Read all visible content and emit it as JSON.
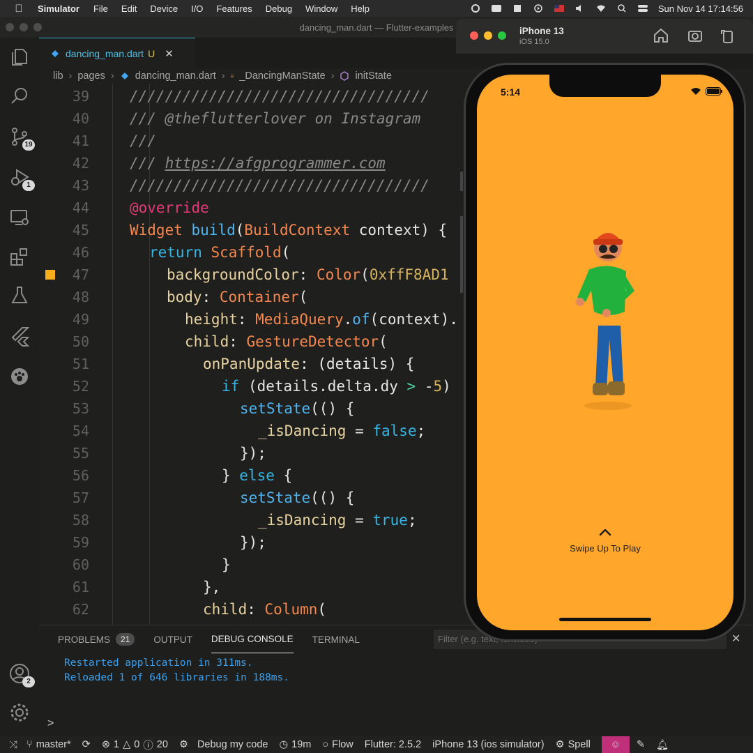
{
  "menubar": {
    "app": "Simulator",
    "items": [
      "File",
      "Edit",
      "Device",
      "I/O",
      "Features",
      "Debug",
      "Window",
      "Help"
    ],
    "clock": "Sun Nov 14  17:14:56"
  },
  "window_title": "dancing_man.dart — Flutter-examples",
  "tab": {
    "label": "dancing_man.dart",
    "status": "U",
    "close": "✕"
  },
  "breadcrumb": [
    "lib",
    "pages",
    "dancing_man.dart",
    "_DancingManState",
    "initState"
  ],
  "activity_badges": {
    "source_control": "19",
    "debug": "1",
    "accounts": "2"
  },
  "code": {
    "line_numbers": [
      "39",
      "40",
      "41",
      "42",
      "43",
      "44",
      "45",
      "46",
      "47",
      "48",
      "49",
      "50",
      "51",
      "52",
      "53",
      "54",
      "55",
      "56",
      "57",
      "58",
      "59",
      "60",
      "61",
      "62"
    ],
    "l39": "//////////////////////////////////",
    "l40": "/// @theflutterlover on Instagram",
    "l41": "///",
    "l42a": "/// ",
    "l42b": "https://afgprogrammer.com",
    "l43": "//////////////////////////////////",
    "l44": "@override",
    "l45a": "Widget",
    "l45b": "build",
    "l45c": "(",
    "l45d": "BuildContext",
    "l45e": " context) {",
    "l46a": "return",
    "l46b": "Scaffold",
    "l46c": "(",
    "l47a": "backgroundColor",
    "l47b": ": ",
    "l47c": "Color",
    "l47d": "(",
    "l47e": "0xffF8AD1",
    "l48a": "body",
    "l48b": ": ",
    "l48c": "Container",
    "l48d": "(",
    "l49a": "height",
    "l49b": ": ",
    "l49c": "MediaQuery",
    "l49d": ".",
    "l49e": "of",
    "l49f": "(context).",
    "l50a": "child",
    "l50b": ": ",
    "l50c": "GestureDetector",
    "l50d": "(",
    "l51a": "onPanUpdate",
    "l51b": ": (details) {",
    "l52a": "if",
    "l52b": " (details.delta.dy ",
    "l52c": ">",
    "l52d": " -",
    "l52e": "5",
    "l52f": ")",
    "l53a": "setState",
    "l53b": "(() {",
    "l54a": "_isDancing",
    "l54b": " = ",
    "l54c": "false",
    "l54d": ";",
    "l55": "});",
    "l56a": "} ",
    "l56b": "else",
    "l56c": " {",
    "l57a": "setState",
    "l57b": "(() {",
    "l58a": "_isDancing",
    "l58b": " = ",
    "l58c": "true",
    "l58d": ";",
    "l59": "});",
    "l60": "}",
    "l61": "},",
    "l62a": "child",
    "l62b": ": ",
    "l62c": "Column",
    "l62d": "("
  },
  "panel": {
    "tabs": [
      "PROBLEMS",
      "OUTPUT",
      "DEBUG CONSOLE",
      "TERMINAL"
    ],
    "problems_count": "21",
    "filter_placeholder": "Filter (e.g. text, !exclude)",
    "console_lines": [
      "Restarted application in 311ms.",
      "Reloaded 1 of 646 libraries in 188ms."
    ],
    "prompt": ">"
  },
  "statusbar": {
    "branch": "master*",
    "errors": "1",
    "warnings": "0",
    "infos": "20",
    "debug": "Debug my code",
    "time": "19m",
    "flow": "Flow",
    "flutter": "Flutter: 2.5.2",
    "device": "iPhone 13 (ios simulator)",
    "spell": "Spell"
  },
  "simulator": {
    "device_name": "iPhone 13",
    "os": "iOS 15.0",
    "phone_time": "5:14",
    "swipe_label": "Swipe Up To Play",
    "background": "#ffa62b"
  }
}
